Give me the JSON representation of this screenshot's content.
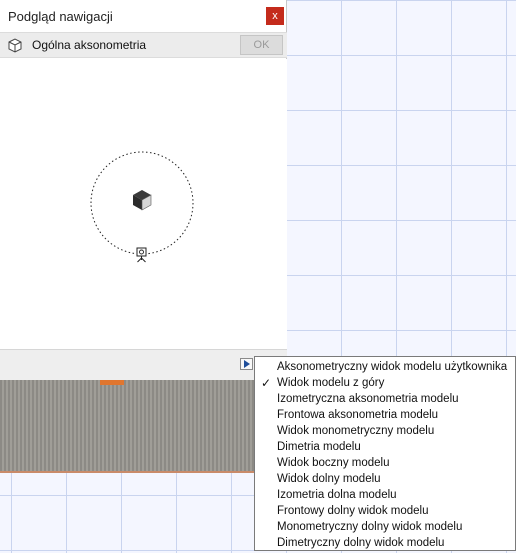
{
  "palette": {
    "title": "Podgląd nawigacji",
    "close_label": "x",
    "view_name": "Ogólna aksonometria",
    "ok_label": "OK"
  },
  "menu": {
    "items": [
      {
        "label": "Aksonometryczny widok modelu użytkownika",
        "checked": false
      },
      {
        "label": "Widok modelu z góry",
        "checked": true,
        "check_mark": "✓"
      },
      {
        "label": "Izometryczna aksonometria modelu",
        "checked": false
      },
      {
        "label": "Frontowa aksonometria modelu",
        "checked": false
      },
      {
        "label": "Widok monometryczny modelu",
        "checked": false
      },
      {
        "label": "Dimetria modelu",
        "checked": false
      },
      {
        "label": "Widok boczny modelu",
        "checked": false
      },
      {
        "label": "Widok dolny modelu",
        "checked": false
      },
      {
        "label": "Izometria dolna modelu",
        "checked": false
      },
      {
        "label": "Frontowy dolny widok modelu",
        "checked": false
      },
      {
        "label": "Monometryczny dolny widok modelu",
        "checked": false
      },
      {
        "label": "Dimetryczny dolny widok modelu",
        "checked": false
      }
    ]
  },
  "colors": {
    "close_button": "#c42b1c",
    "grid_line": "#c9d4ef",
    "model_accent": "#e0762f"
  },
  "icons": {
    "view_icon": "cube-outline-icon",
    "model_icon": "cube-icon",
    "camera_icon": "camera-icon",
    "menu_arrow": "triangle-right-icon"
  }
}
